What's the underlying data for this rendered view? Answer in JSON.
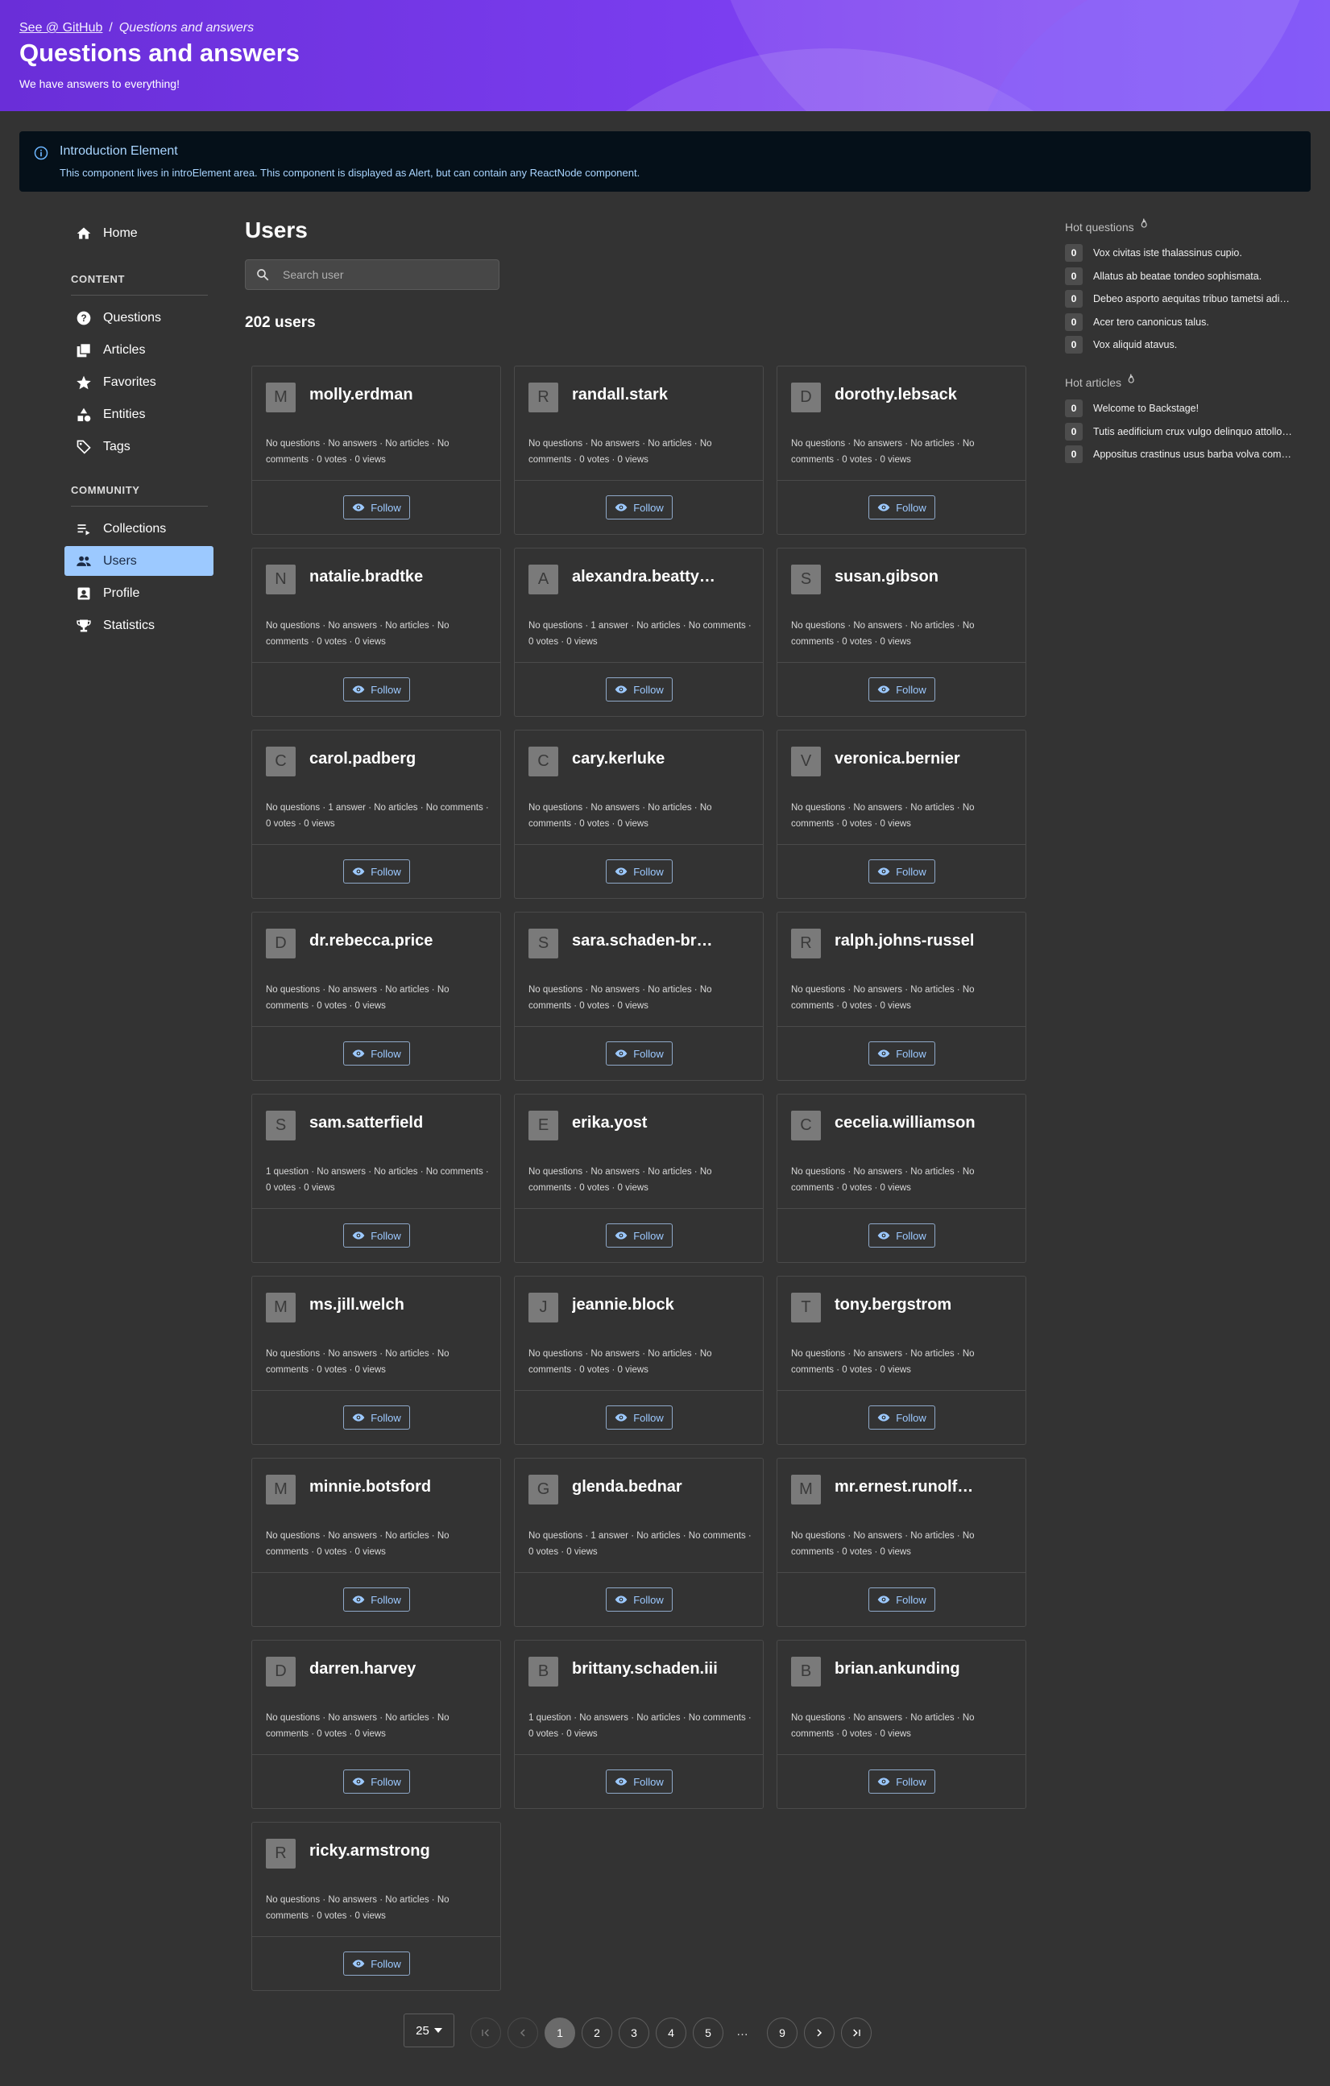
{
  "header": {
    "breadcrumb_link": "See @ GitHub",
    "breadcrumb_separator": "/",
    "breadcrumb_current": "Questions and answers",
    "title": "Questions and answers",
    "subtitle": "We have answers to everything!"
  },
  "alert": {
    "title": "Introduction Element",
    "body": "This component lives in introElement area. This component is displayed as Alert, but can contain any ReactNode component."
  },
  "sidebar": {
    "home": "Home",
    "content_heading": "CONTENT",
    "community_heading": "COMMUNITY",
    "content_items": [
      {
        "label": "Questions",
        "icon": "help-circle-icon"
      },
      {
        "label": "Articles",
        "icon": "library-icon"
      },
      {
        "label": "Favorites",
        "icon": "star-icon"
      },
      {
        "label": "Entities",
        "icon": "category-icon"
      },
      {
        "label": "Tags",
        "icon": "tag-icon"
      }
    ],
    "community_items": [
      {
        "label": "Collections",
        "icon": "playlist-icon"
      },
      {
        "label": "Users",
        "icon": "people-icon",
        "active": true
      },
      {
        "label": "Profile",
        "icon": "account-box-icon"
      },
      {
        "label": "Statistics",
        "icon": "trophy-icon"
      }
    ]
  },
  "main": {
    "title": "Users",
    "search_placeholder": "Search user",
    "count": "202 users",
    "follow_label": "Follow",
    "users": [
      {
        "initial": "M",
        "name": "molly.erdman",
        "stats": "No questions · No answers · No articles · No comments · 0 votes · 0 views"
      },
      {
        "initial": "R",
        "name": "randall.stark",
        "stats": "No questions · No answers · No articles · No comments · 0 votes · 0 views"
      },
      {
        "initial": "D",
        "name": "dorothy.lebsack",
        "stats": "No questions · No answers · No articles · No comments · 0 votes · 0 views"
      },
      {
        "initial": "N",
        "name": "natalie.bradtke",
        "stats": "No questions · No answers · No articles · No comments · 0 votes · 0 views"
      },
      {
        "initial": "A",
        "name": "alexandra.beatty…",
        "stats": "No questions · 1 answer · No articles · No comments · 0 votes · 0 views"
      },
      {
        "initial": "S",
        "name": "susan.gibson",
        "stats": "No questions · No answers · No articles · No comments · 0 votes · 0 views"
      },
      {
        "initial": "C",
        "name": "carol.padberg",
        "stats": "No questions · 1 answer · No articles · No comments · 0 votes · 0 views"
      },
      {
        "initial": "C",
        "name": "cary.kerluke",
        "stats": "No questions · No answers · No articles · No comments · 0 votes · 0 views"
      },
      {
        "initial": "V",
        "name": "veronica.bernier",
        "stats": "No questions · No answers · No articles · No comments · 0 votes · 0 views"
      },
      {
        "initial": "D",
        "name": "dr.rebecca.price",
        "stats": "No questions · No answers · No articles · No comments · 0 votes · 0 views"
      },
      {
        "initial": "S",
        "name": "sara.schaden-br…",
        "stats": "No questions · No answers · No articles · No comments · 0 votes · 0 views"
      },
      {
        "initial": "R",
        "name": "ralph.johns-russel",
        "stats": "No questions · No answers · No articles · No comments · 0 votes · 0 views"
      },
      {
        "initial": "S",
        "name": "sam.satterfield",
        "stats": "1 question · No answers · No articles · No comments · 0 votes · 0 views"
      },
      {
        "initial": "E",
        "name": "erika.yost",
        "stats": "No questions · No answers · No articles · No comments · 0 votes · 0 views"
      },
      {
        "initial": "C",
        "name": "cecelia.williamson",
        "stats": "No questions · No answers · No articles · No comments · 0 votes · 0 views"
      },
      {
        "initial": "M",
        "name": "ms.jill.welch",
        "stats": "No questions · No answers · No articles · No comments · 0 votes · 0 views"
      },
      {
        "initial": "J",
        "name": "jeannie.block",
        "stats": "No questions · No answers · No articles · No comments · 0 votes · 0 views"
      },
      {
        "initial": "T",
        "name": "tony.bergstrom",
        "stats": "No questions · No answers · No articles · No comments · 0 votes · 0 views"
      },
      {
        "initial": "M",
        "name": "minnie.botsford",
        "stats": "No questions · No answers · No articles · No comments · 0 votes · 0 views"
      },
      {
        "initial": "G",
        "name": "glenda.bednar",
        "stats": "No questions · 1 answer · No articles · No comments · 0 votes · 0 views"
      },
      {
        "initial": "M",
        "name": "mr.ernest.runolf…",
        "stats": "No questions · No answers · No articles · No comments · 0 votes · 0 views"
      },
      {
        "initial": "D",
        "name": "darren.harvey",
        "stats": "No questions · No answers · No articles · No comments · 0 votes · 0 views"
      },
      {
        "initial": "B",
        "name": "brittany.schaden.iii",
        "stats": "1 question · No answers · No articles · No comments · 0 votes · 0 views"
      },
      {
        "initial": "B",
        "name": "brian.ankunding",
        "stats": "No questions · No answers · No articles · No comments · 0 votes · 0 views"
      },
      {
        "initial": "R",
        "name": "ricky.armstrong",
        "stats": "No questions · No answers · No articles · No comments · 0 votes · 0 views"
      }
    ]
  },
  "hot_questions": {
    "title": "Hot questions",
    "items": [
      {
        "count": "0",
        "text": "Vox civitas iste thalassinus cupio."
      },
      {
        "count": "0",
        "text": "Allatus ab beatae tondeo sophismata."
      },
      {
        "count": "0",
        "text": "Debeo asporto aequitas tribuo tametsi adi…"
      },
      {
        "count": "0",
        "text": "Acer tero canonicus talus."
      },
      {
        "count": "0",
        "text": "Vox aliquid atavus."
      }
    ]
  },
  "hot_articles": {
    "title": "Hot articles",
    "items": [
      {
        "count": "0",
        "text": "Welcome to Backstage!"
      },
      {
        "count": "0",
        "text": "Tutis aedificium crux vulgo delinquo attollo…"
      },
      {
        "count": "0",
        "text": "Appositus crastinus usus barba volva com…"
      }
    ]
  },
  "pagination": {
    "per_page": "25",
    "pages": [
      "1",
      "2",
      "3",
      "4",
      "5"
    ],
    "ellipsis": "…",
    "last_page": "9",
    "current": "1"
  },
  "colors": {
    "header_gradient_start": "#6a2ed8",
    "header_gradient_end": "#8c5cf5",
    "active_nav": "#9cc9ff",
    "background": "#333333",
    "alert_background": "#051019"
  }
}
